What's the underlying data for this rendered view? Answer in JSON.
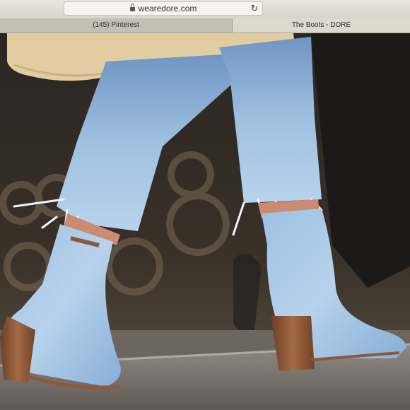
{
  "browser": {
    "address": "wearedore.com",
    "tabs": [
      {
        "label": "(145) Pinterest"
      },
      {
        "label": "The Boots - DORÉ"
      }
    ]
  },
  "icons": {
    "lock": "lock-icon",
    "reload": "reload-icon"
  },
  "colors": {
    "denim_light": "#a9c9e6",
    "denim_mid": "#7fa8d3",
    "heel_wood": "#8b5a3c",
    "coat": "#e4cfa4"
  }
}
